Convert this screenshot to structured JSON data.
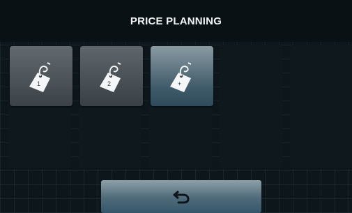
{
  "header": {
    "title": "PRICE PLANNING"
  },
  "tiles": [
    {
      "icon": "price-tag-icon",
      "label": "1"
    },
    {
      "icon": "price-tag-icon",
      "label": "2"
    },
    {
      "icon": "price-tag-add-icon",
      "label": "+"
    }
  ],
  "footer": {
    "back_icon": "return-arrow-icon"
  },
  "colors": {
    "background": "#0c1419",
    "tile": "#4a5156",
    "tile_active": "#3f5a68",
    "text": "#f2f5f6"
  }
}
